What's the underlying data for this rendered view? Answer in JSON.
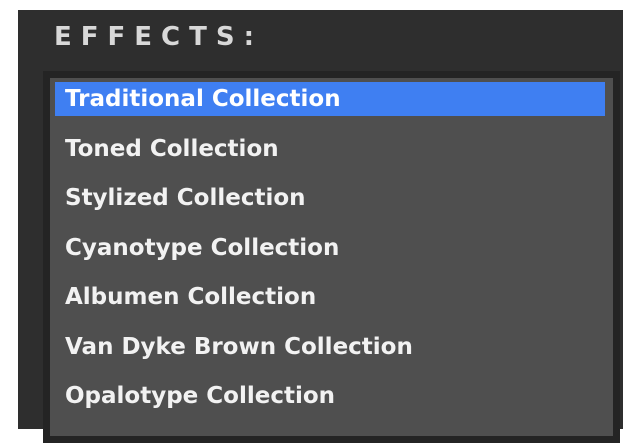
{
  "panel": {
    "title": "EFFECTS:"
  },
  "effects_list": {
    "selected_index": 0,
    "items": [
      {
        "label": "Traditional Collection"
      },
      {
        "label": "Toned Collection"
      },
      {
        "label": "Stylized Collection"
      },
      {
        "label": "Cyanotype Collection"
      },
      {
        "label": "Albumen Collection"
      },
      {
        "label": "Van Dyke Brown Collection"
      },
      {
        "label": "Opalotype Collection"
      }
    ]
  },
  "colors": {
    "panel_background": "#2e2e2e",
    "list_background": "#4f4f4f",
    "selection_highlight": "#3f7ff2",
    "title_text": "#d8d8d8",
    "item_text": "#f2f2f2"
  }
}
